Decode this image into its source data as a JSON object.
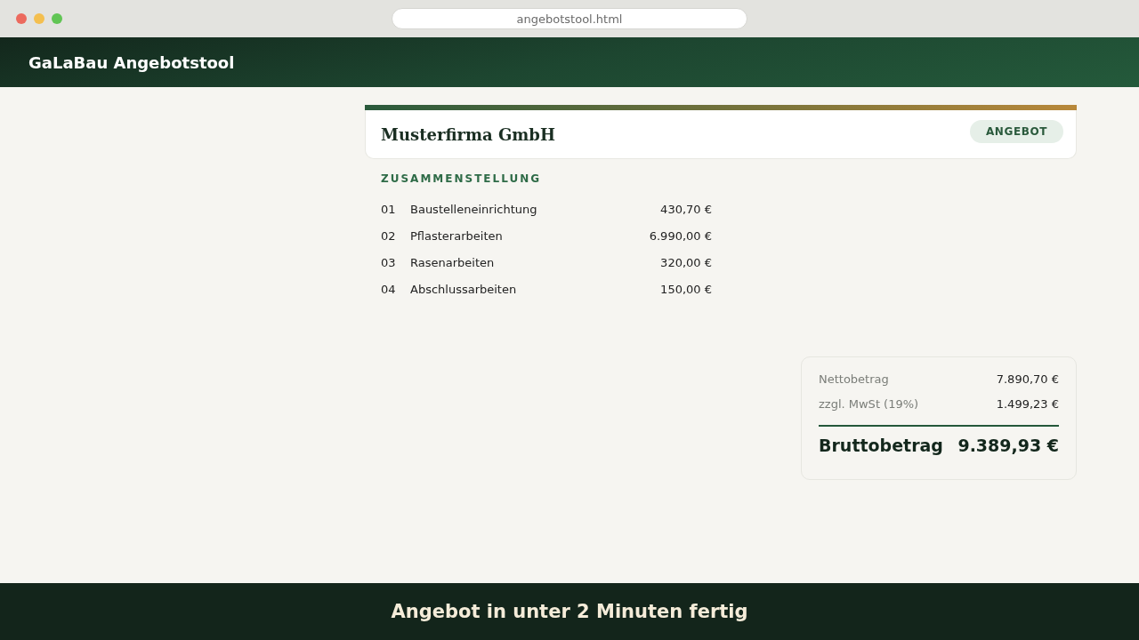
{
  "browser": {
    "url": "angebotstool.html"
  },
  "header": {
    "title": "GaLaBau Angebotstool"
  },
  "offer_card": {
    "company": "Musterfirma GmbH",
    "badge": "ANGEBOT"
  },
  "summary": {
    "heading": "ZUSAMMENSTELLUNG",
    "items": [
      {
        "number": "01",
        "name": "Baustelleneinrichtung",
        "amount": "430,70 €"
      },
      {
        "number": "02",
        "name": "Pflasterarbeiten",
        "amount": "6.990,00 €"
      },
      {
        "number": "03",
        "name": "Rasenarbeiten",
        "amount": "320,00 €"
      },
      {
        "number": "04",
        "name": "Abschlussarbeiten",
        "amount": "150,00 €"
      }
    ]
  },
  "totals": {
    "rows": [
      {
        "label": "Nettobetrag",
        "value": "7.890,70 €"
      },
      {
        "label": "zzgl. MwSt (19%)",
        "value": "1.499,23 €"
      }
    ],
    "gross": {
      "label": "Bruttobetrag",
      "value": "9.389,93 €"
    }
  },
  "footer": {
    "tagline": "Angebot in unter 2 Minuten fertig"
  }
}
